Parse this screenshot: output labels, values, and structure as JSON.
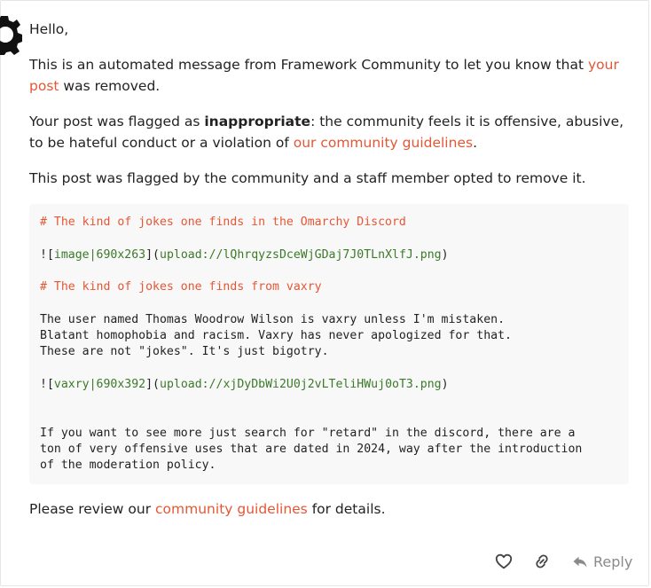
{
  "message": {
    "greeting": "Hello,",
    "intro_before": "This is an automated message from Framework Community to let you know that ",
    "intro_link": "your post",
    "intro_after": " was removed.",
    "flag_before": "Your post was flagged as ",
    "flag_strong": "inappropriate",
    "flag_middle": ": the community feels it is offensive, abusive, to be hateful conduct or a violation of ",
    "flag_link": "our community guidelines",
    "flag_after": ".",
    "staff_note": "This post was flagged by the community and a staff member opted to remove it.",
    "review_before": "Please review our ",
    "review_link": "community guidelines",
    "review_after": " for details."
  },
  "code": {
    "heading1": "# The kind of jokes one finds in the Omarchy Discord",
    "img1_open": "![",
    "img1_alt": "image|690x263",
    "img1_mid": "](",
    "img1_url": "upload://lQhrqyzsDceWjGDaj7J0TLnXlfJ.png",
    "img1_close": ")",
    "heading2": "# The kind of jokes one finds from vaxry",
    "body1": "The user named Thomas Woodrow Wilson is vaxry unless I'm mistaken.",
    "body2": "Blatant homophobia and racism. Vaxry has never apologized for that.",
    "body3": "These are not \"jokes\". It's just bigotry.",
    "img2_open": "![",
    "img2_alt": "vaxry|690x392",
    "img2_mid": "](",
    "img2_url": "upload://xjDyDbWi2U0j2vLTeliHWuj0oT3.png",
    "img2_close": ")",
    "tail1": "If you want to see more just search for \"retard\" in the discord, there are a",
    "tail2": "ton of very offensive uses that are dated in 2024, way after the introduction",
    "tail3": "of the moderation policy."
  },
  "actions": {
    "reply_label": "Reply",
    "like_icon": "heart-icon",
    "link_icon": "link-icon",
    "reply_icon": "reply-arrow-icon"
  },
  "colors": {
    "accent": "#e45735",
    "code_green": "#3a7a28",
    "muted": "#8a8a8a"
  }
}
